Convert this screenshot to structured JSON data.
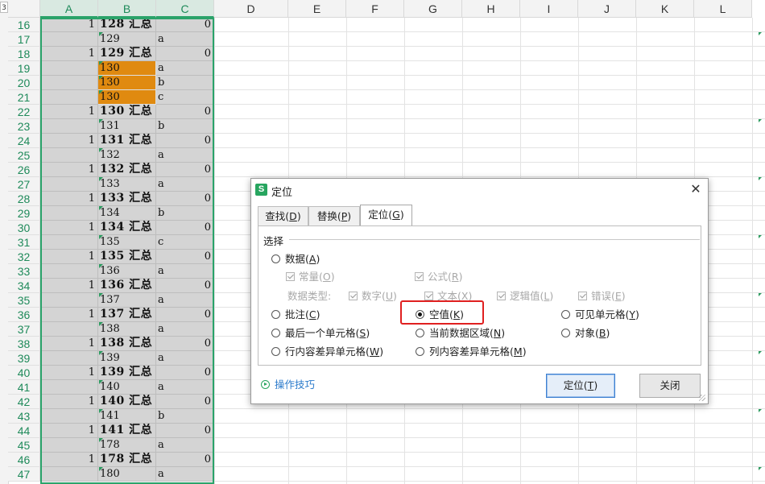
{
  "sheet": {
    "gutter_label": "3",
    "column_headers": [
      "A",
      "B",
      "C",
      "D",
      "E",
      "F",
      "G",
      "H",
      "I",
      "J",
      "K",
      "L"
    ],
    "rows": [
      {
        "n": "16",
        "a": "1",
        "b": "128 汇总",
        "c": "0",
        "total": true
      },
      {
        "n": "17",
        "a": "",
        "b": "129",
        "c": "a",
        "total": false
      },
      {
        "n": "18",
        "a": "1",
        "b": "129 汇总",
        "c": "0",
        "total": true
      },
      {
        "n": "19",
        "a": "",
        "b": "130",
        "c": "a",
        "total": false,
        "orange": true
      },
      {
        "n": "20",
        "a": "",
        "b": "130",
        "c": "b",
        "total": false,
        "orange": true
      },
      {
        "n": "21",
        "a": "",
        "b": "130",
        "c": "c",
        "total": false,
        "orange": true
      },
      {
        "n": "22",
        "a": "1",
        "b": "130 汇总",
        "c": "0",
        "total": true
      },
      {
        "n": "23",
        "a": "",
        "b": "131",
        "c": "b",
        "total": false
      },
      {
        "n": "24",
        "a": "1",
        "b": "131 汇总",
        "c": "0",
        "total": true
      },
      {
        "n": "25",
        "a": "",
        "b": "132",
        "c": "a",
        "total": false
      },
      {
        "n": "26",
        "a": "1",
        "b": "132 汇总",
        "c": "0",
        "total": true
      },
      {
        "n": "27",
        "a": "",
        "b": "133",
        "c": "a",
        "total": false
      },
      {
        "n": "28",
        "a": "1",
        "b": "133 汇总",
        "c": "0",
        "total": true
      },
      {
        "n": "29",
        "a": "",
        "b": "134",
        "c": "b",
        "total": false
      },
      {
        "n": "30",
        "a": "1",
        "b": "134 汇总",
        "c": "0",
        "total": true
      },
      {
        "n": "31",
        "a": "",
        "b": "135",
        "c": "c",
        "total": false
      },
      {
        "n": "32",
        "a": "1",
        "b": "135 汇总",
        "c": "0",
        "total": true
      },
      {
        "n": "33",
        "a": "",
        "b": "136",
        "c": "a",
        "total": false
      },
      {
        "n": "34",
        "a": "1",
        "b": "136 汇总",
        "c": "0",
        "total": true
      },
      {
        "n": "35",
        "a": "",
        "b": "137",
        "c": "a",
        "total": false
      },
      {
        "n": "36",
        "a": "1",
        "b": "137 汇总",
        "c": "0",
        "total": true
      },
      {
        "n": "37",
        "a": "",
        "b": "138",
        "c": "a",
        "total": false
      },
      {
        "n": "38",
        "a": "1",
        "b": "138 汇总",
        "c": "0",
        "total": true
      },
      {
        "n": "39",
        "a": "",
        "b": "139",
        "c": "a",
        "total": false
      },
      {
        "n": "40",
        "a": "1",
        "b": "139 汇总",
        "c": "0",
        "total": true
      },
      {
        "n": "41",
        "a": "",
        "b": "140",
        "c": "a",
        "total": false
      },
      {
        "n": "42",
        "a": "1",
        "b": "140 汇总",
        "c": "0",
        "total": true
      },
      {
        "n": "43",
        "a": "",
        "b": "141",
        "c": "b",
        "total": false
      },
      {
        "n": "44",
        "a": "1",
        "b": "141 汇总",
        "c": "0",
        "total": true
      },
      {
        "n": "45",
        "a": "",
        "b": "178",
        "c": "a",
        "total": false
      },
      {
        "n": "46",
        "a": "1",
        "b": "178 汇总",
        "c": "0",
        "total": true
      },
      {
        "n": "47",
        "a": "",
        "b": "180",
        "c": "a",
        "total": false
      }
    ],
    "colors": {
      "selection": "#2aa36a",
      "highlight_fill": "#e08a10",
      "selected_cell_bg": "#d4d4d4"
    }
  },
  "dialog": {
    "title": "定位",
    "icon_letter": "S",
    "close_glyph": "✕",
    "tabs": [
      {
        "label": "查找(",
        "key": "D",
        "end": ")",
        "active": false
      },
      {
        "label": "替换(",
        "key": "P",
        "end": ")",
        "active": false
      },
      {
        "label": "定位(",
        "key": "G",
        "end": ")",
        "active": true
      }
    ],
    "group_label": "选择",
    "options": {
      "data": {
        "text": "数据(",
        "key": "A",
        "end": ")",
        "selected": false
      },
      "constant": {
        "text": "常量(",
        "key": "O",
        "end": ")",
        "checked": true
      },
      "formula": {
        "text": "公式(",
        "key": "R",
        "end": ")",
        "checked": true
      },
      "data_type_label": "数据类型:",
      "number": {
        "text": "数字(",
        "key": "U",
        "end": ")",
        "checked": true
      },
      "text": {
        "text": "文本(",
        "key": "X",
        "end": ")",
        "checked": true
      },
      "logical": {
        "text": "逻辑值(",
        "key": "L",
        "end": ")",
        "checked": true
      },
      "error": {
        "text": "错误(",
        "key": "E",
        "end": ")",
        "checked": true
      },
      "comment": {
        "text": "批注(",
        "key": "C",
        "end": ")",
        "selected": false
      },
      "blank": {
        "text": "空值(",
        "key": "K",
        "end": ")",
        "selected": true
      },
      "visible": {
        "text": "可见单元格(",
        "key": "Y",
        "end": ")",
        "selected": false
      },
      "last_cell": {
        "text": "最后一个单元格(",
        "key": "S",
        "end": ")",
        "selected": false
      },
      "current_region": {
        "text": "当前数据区域(",
        "key": "N",
        "end": ")",
        "selected": false
      },
      "object": {
        "text": "对象(",
        "key": "B",
        "end": ")",
        "selected": false
      },
      "row_diff": {
        "text": "行内容差异单元格(",
        "key": "W",
        "end": ")",
        "selected": false
      },
      "col_diff": {
        "text": "列内容差异单元格(",
        "key": "M",
        "end": ")",
        "selected": false
      }
    },
    "tips_link": "操作技巧",
    "locate_button": {
      "text": "定位(",
      "key": "T",
      "end": ")"
    },
    "close_button": "关闭",
    "highlight_color": "#e02020"
  }
}
